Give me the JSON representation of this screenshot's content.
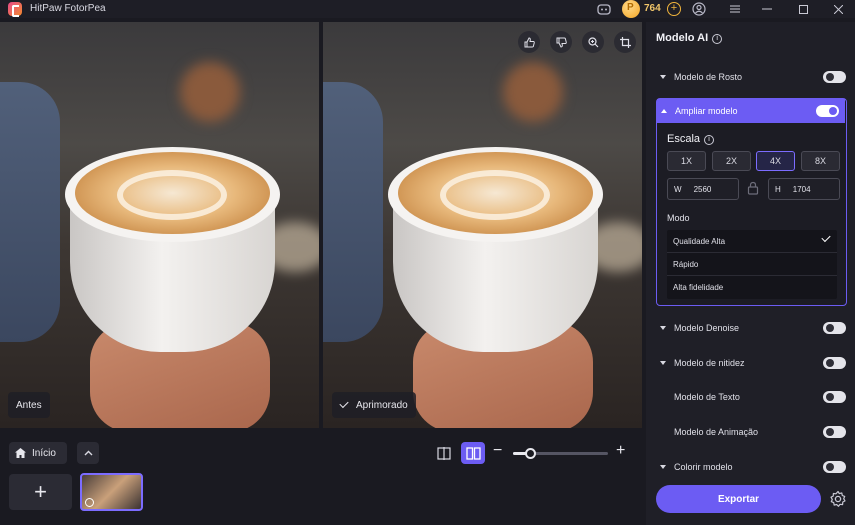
{
  "app": {
    "title": "HitPaw FotorPea",
    "coins": "764"
  },
  "icons": {
    "logo": "fotorpea-logo-icon",
    "discord": "discord-icon",
    "coin": "coin-icon",
    "add_coins": "plus-circle-icon",
    "account": "user-icon",
    "menu": "hamburger-menu-icon",
    "minimize": "minimize-icon",
    "maximize": "maximize-icon",
    "close": "close-icon"
  },
  "viewer": {
    "before_label": "Antes",
    "after_label": "Aprimorado",
    "tools": [
      "thumbs-up-icon",
      "thumbs-down-icon",
      "zoom-icon",
      "crop-icon"
    ]
  },
  "bottom": {
    "home_label": "Início",
    "zoom_level": 0.18
  },
  "panel": {
    "title": "Modelo AI",
    "face_model": {
      "label": "Modelo de Rosto",
      "on": false
    },
    "upscale_model": {
      "label": "Ampliar modelo",
      "on": true,
      "scale_label": "Escala",
      "scales": [
        "1X",
        "2X",
        "4X",
        "8X"
      ],
      "selected_scale": "4X",
      "width_label": "W",
      "width": "2560",
      "height_label": "H",
      "height": "1704",
      "mode_label": "Modo",
      "modes": [
        "Qualidade Alta",
        "Rápido",
        "Alta fidelidade"
      ],
      "selected_mode": "Qualidade Alta"
    },
    "denoise_model": {
      "label": "Modelo Denoise",
      "on": false
    },
    "sharpness_model": {
      "label": "Modelo de nitidez",
      "on": false
    },
    "text_model": {
      "label": "Modelo de Texto",
      "on": false
    },
    "animation_model": {
      "label": "Modelo de Animação",
      "on": false
    },
    "colorize_model": {
      "label": "Colorir modelo",
      "on": false
    },
    "export_label": "Exportar"
  },
  "colors": {
    "accent": "#6c5cf3",
    "panel_bg": "#1f1f27",
    "app_bg": "#1a1a21"
  }
}
